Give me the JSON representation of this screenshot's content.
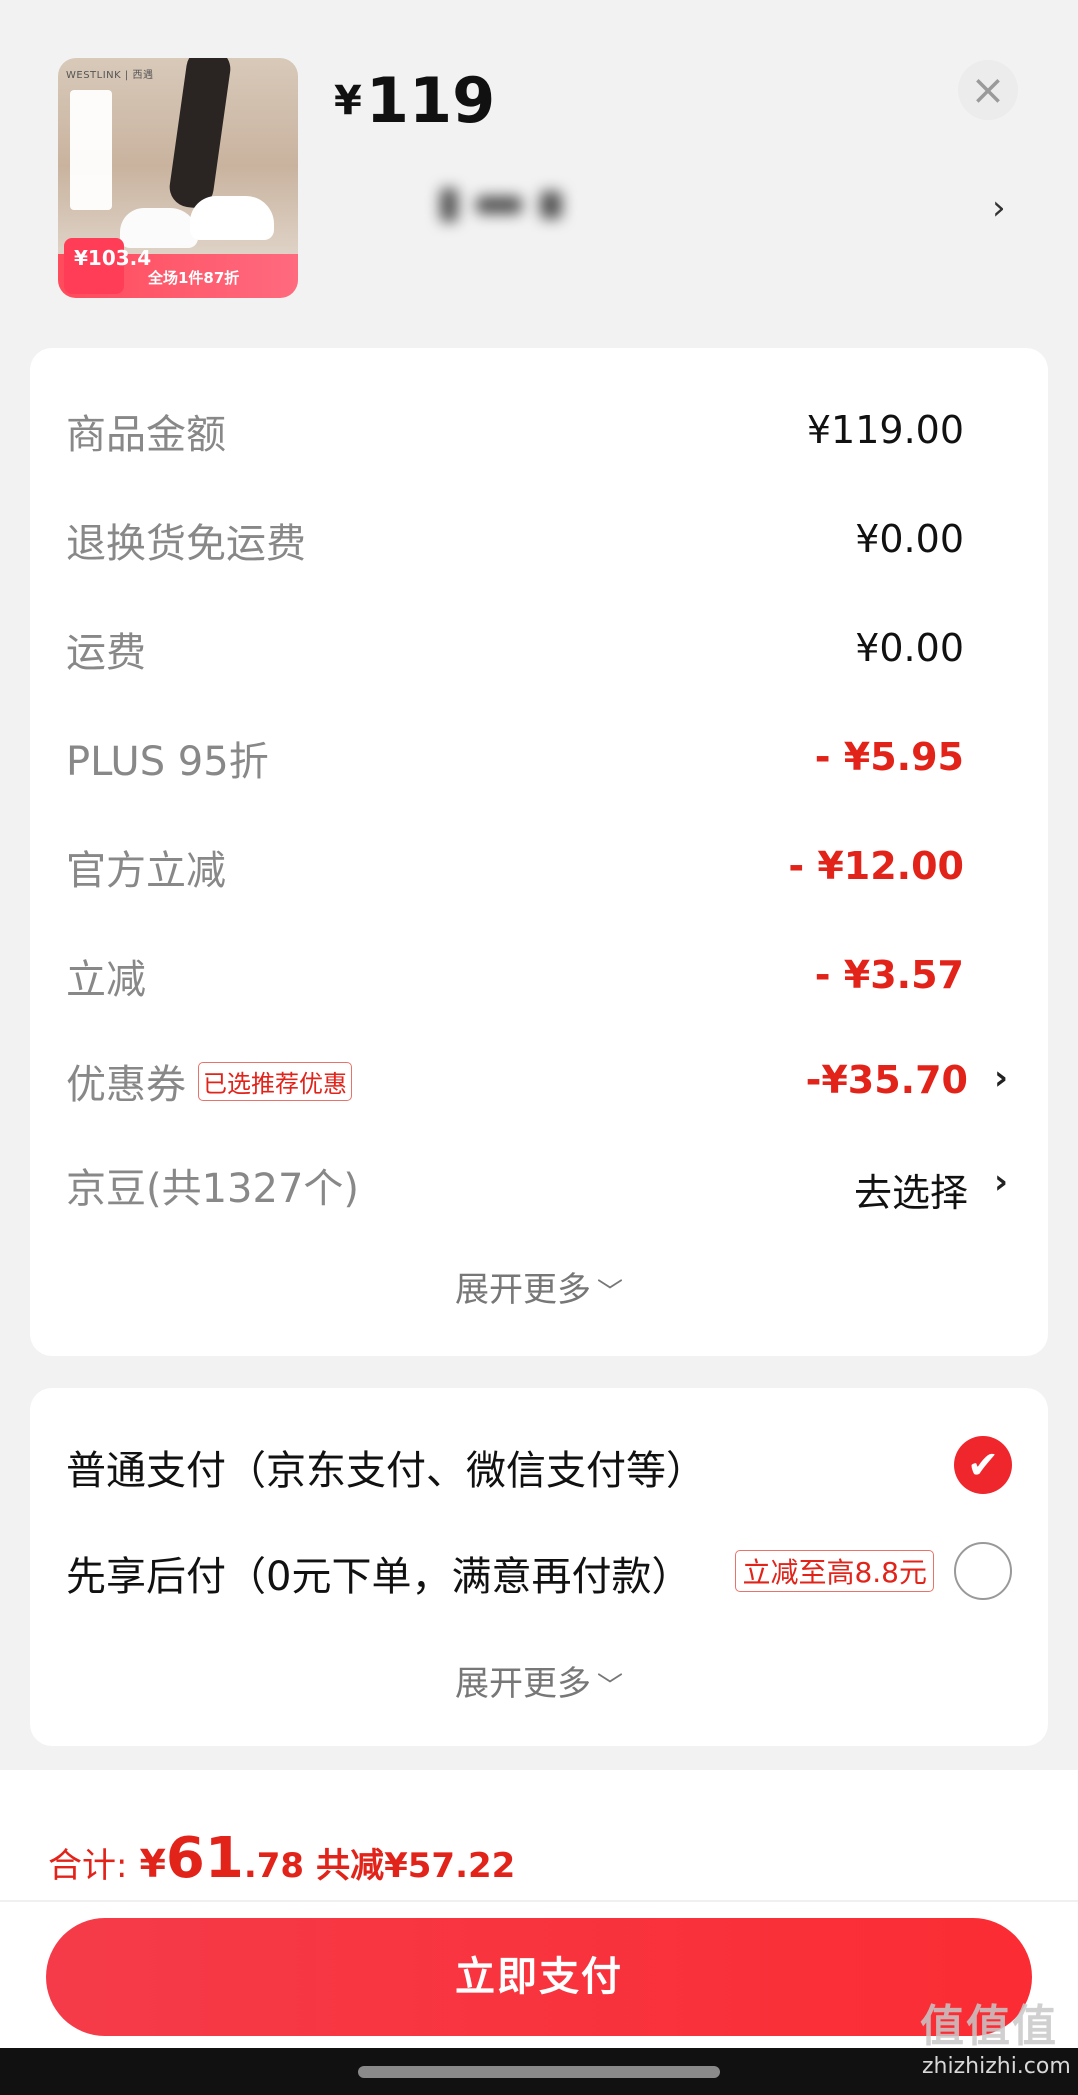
{
  "header": {
    "thumbnail": {
      "brand_text": "WESTLINK | 西遇",
      "promo_price": "¥103.4",
      "promo_text": "全场1件87折"
    },
    "price_symbol": "¥",
    "price": "119",
    "close_icon": "close-icon",
    "sku_chevron": "›"
  },
  "summary": {
    "rows": [
      {
        "label": "商品金额",
        "value": "¥119.00",
        "style": "normal"
      },
      {
        "label": "退换货免运费",
        "value": "¥0.00",
        "style": "normal"
      },
      {
        "label": "运费",
        "value": "¥0.00",
        "style": "normal"
      },
      {
        "label": "PLUS 95折",
        "value": "- ¥5.95",
        "style": "discount"
      },
      {
        "label": "官方立减",
        "value": "- ¥12.00",
        "style": "discount"
      },
      {
        "label": "立减",
        "value": "- ¥3.57",
        "style": "discount"
      },
      {
        "label": "优惠券",
        "tag": "已选推荐优惠",
        "value": "-¥35.70",
        "style": "discount",
        "chevron": "›"
      },
      {
        "label": "京豆(共1327个)",
        "value": "去选择",
        "style": "normal",
        "chevron": "›"
      }
    ],
    "expand_label": "展开更多",
    "expand_arrow": "﹀"
  },
  "payment": {
    "options": [
      {
        "label": "普通支付（京东支付、微信支付等）",
        "selected": true
      },
      {
        "label": "先享后付（0元下单，满意再付款）",
        "tag": "立减至高8.8元",
        "selected": false
      }
    ],
    "check_icon": "✔",
    "expand_label": "展开更多",
    "expand_arrow": "﹀"
  },
  "footer": {
    "total_label": "合计:",
    "total_yen": "¥",
    "total_int": "61",
    "total_dec": ".78",
    "saved_text": "共减¥57.22",
    "pay_button": "立即支付"
  },
  "watermark": {
    "text": "值值值",
    "sub": "zhizhizhi.com"
  },
  "colors": {
    "accent_red": "#e2231a",
    "button_gradient_start": "#f53b49",
    "button_gradient_end": "#fb2c33"
  }
}
